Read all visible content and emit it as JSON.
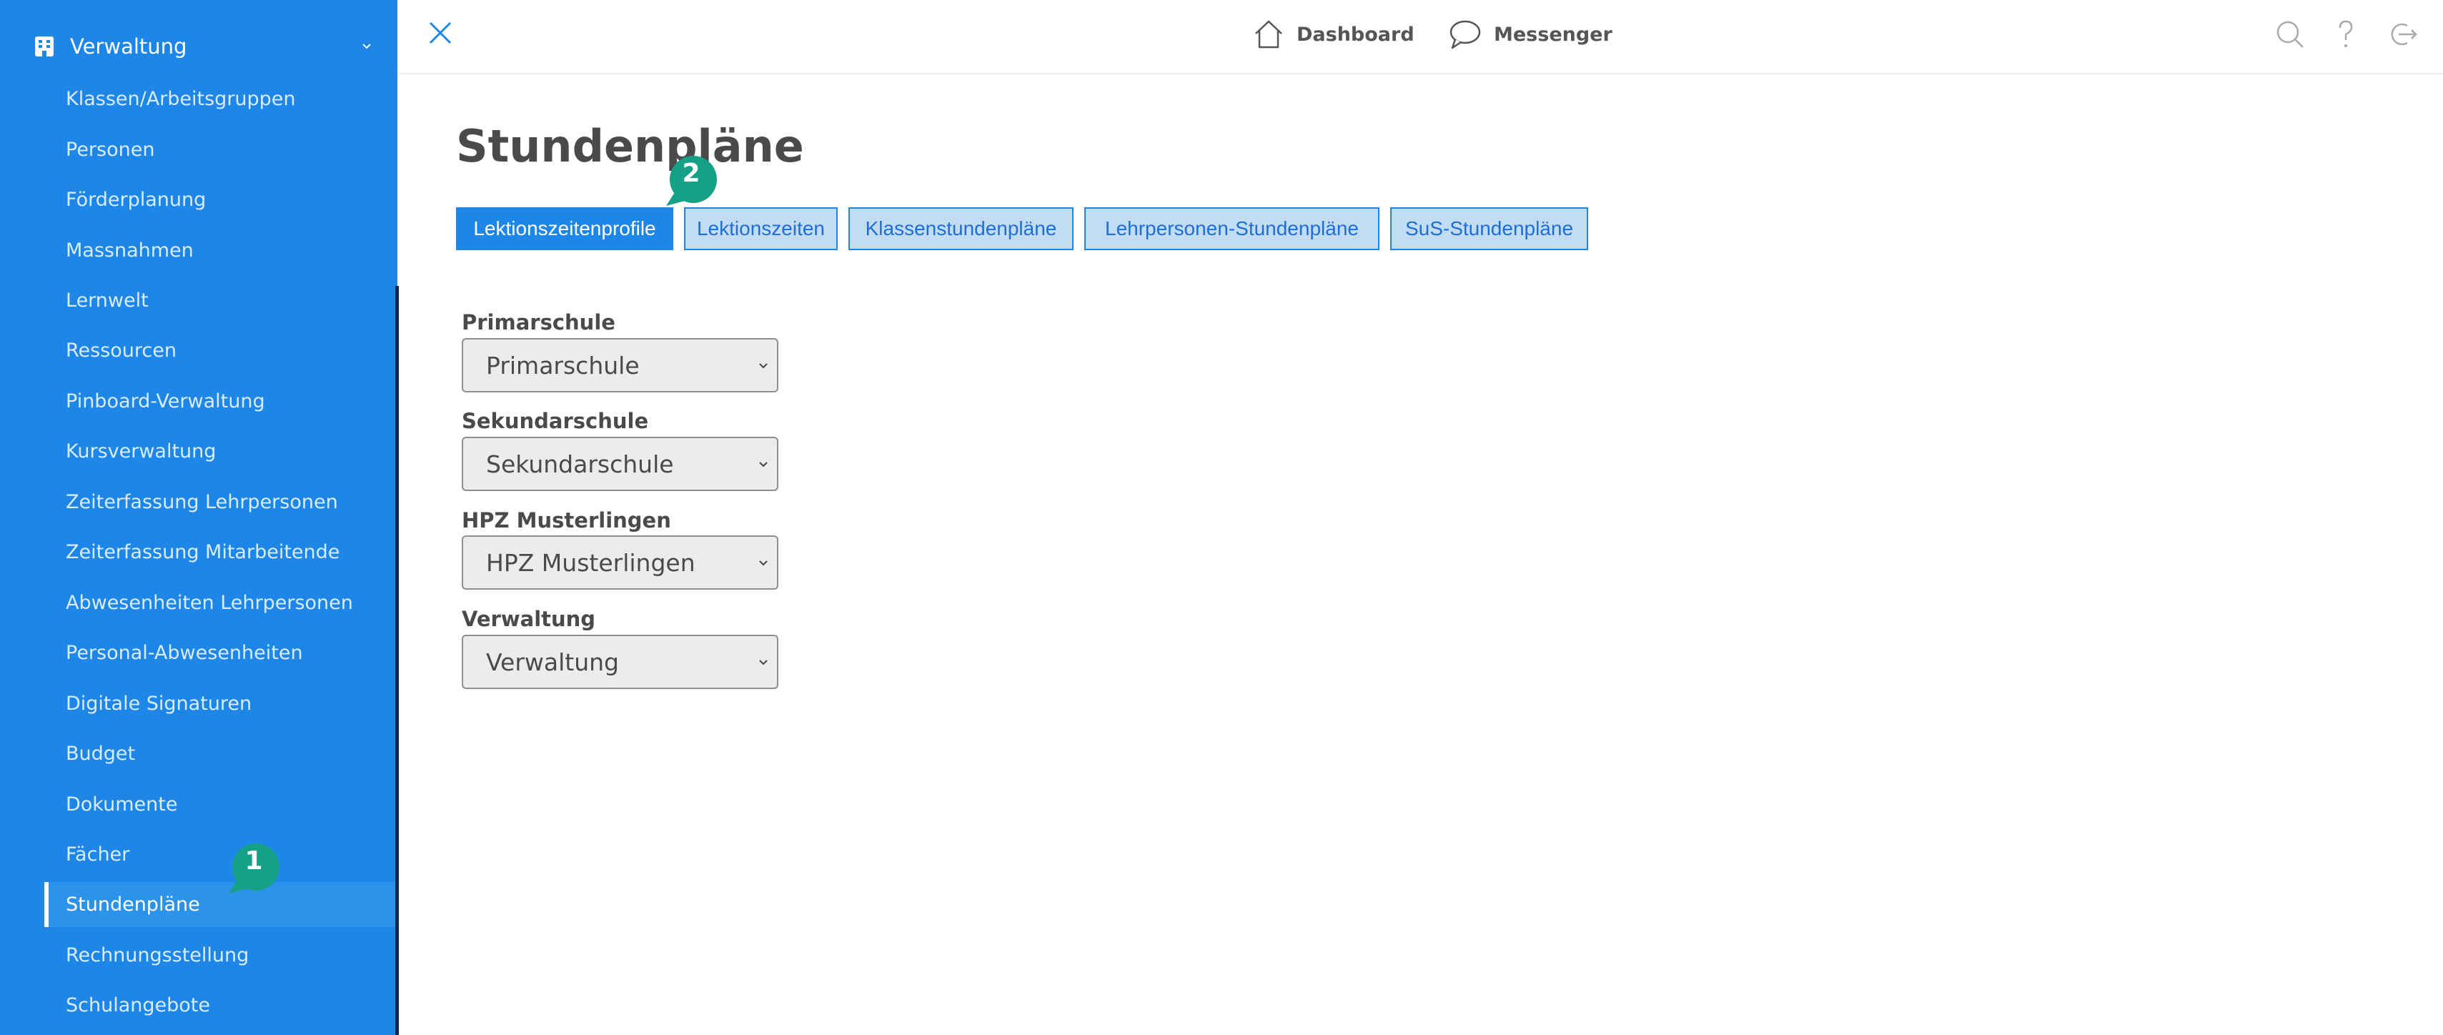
{
  "sidebar": {
    "section_title": "Verwaltung",
    "items": [
      {
        "label": "Klassen/Arbeitsgruppen"
      },
      {
        "label": "Personen"
      },
      {
        "label": "Förderplanung"
      },
      {
        "label": "Massnahmen"
      },
      {
        "label": "Lernwelt"
      },
      {
        "label": "Ressourcen"
      },
      {
        "label": "Pinboard-Verwaltung"
      },
      {
        "label": "Kursverwaltung"
      },
      {
        "label": "Zeiterfassung Lehrpersonen"
      },
      {
        "label": "Zeiterfassung Mitarbeitende"
      },
      {
        "label": "Abwesenheiten Lehrpersonen"
      },
      {
        "label": "Personal-Abwesenheiten"
      },
      {
        "label": "Digitale Signaturen"
      },
      {
        "label": "Budget"
      },
      {
        "label": "Dokumente"
      },
      {
        "label": "Fächer"
      },
      {
        "label": "Stundenpläne",
        "active": true
      },
      {
        "label": "Rechnungsstellung"
      },
      {
        "label": "Schulangebote"
      }
    ]
  },
  "topbar": {
    "dashboard_label": "Dashboard",
    "messenger_label": "Messenger",
    "icons": [
      "close-icon",
      "home-icon",
      "chat-icon",
      "search-icon",
      "help-icon",
      "logout-icon"
    ]
  },
  "main": {
    "title": "Stundenpläne",
    "tabs": [
      {
        "label": "Lektionszeitenprofile",
        "active": true
      },
      {
        "label": "Lektionszeiten"
      },
      {
        "label": "Klassenstundenpläne"
      },
      {
        "label": "Lehrpersonen-Stundenpläne"
      },
      {
        "label": "SuS-Stundenpläne"
      }
    ],
    "fields": [
      {
        "label": "Primarschule",
        "value": "Primarschule"
      },
      {
        "label": "Sekundarschule",
        "value": "Sekundarschule"
      },
      {
        "label": "HPZ Musterlingen",
        "value": "HPZ Musterlingen"
      },
      {
        "label": "Verwaltung",
        "value": "Verwaltung"
      }
    ]
  },
  "annotations": [
    {
      "number": "1"
    },
    {
      "number": "2"
    }
  ],
  "colors": {
    "sidebar_bg": "#1d86e6",
    "accent": "#1d86e6",
    "tab_inactive_bg": "#c2dcf3",
    "bubble": "#16a085"
  }
}
